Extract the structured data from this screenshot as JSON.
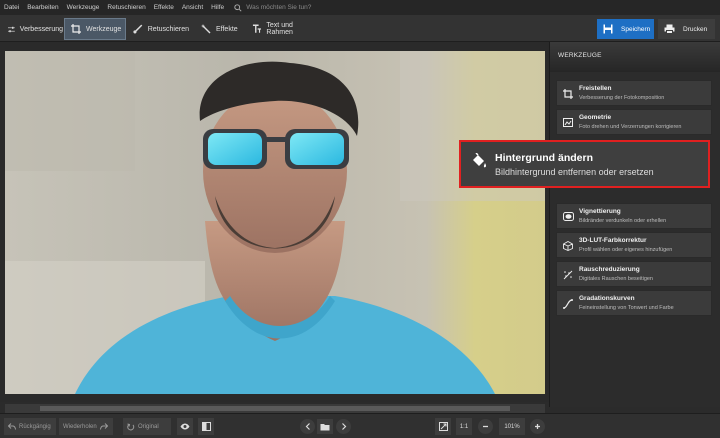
{
  "menu": [
    "Datei",
    "Bearbeiten",
    "Werkzeuge",
    "Retuschieren",
    "Effekte",
    "Ansicht",
    "Hilfe"
  ],
  "search": {
    "placeholder": "Was möchten Sie tun?"
  },
  "tabs": [
    {
      "label": "Verbesserung",
      "icon": "sliders-icon"
    },
    {
      "label": "Werkzeuge",
      "icon": "crop-icon",
      "active": true
    },
    {
      "label": "Retuschieren",
      "icon": "brush-icon"
    },
    {
      "label": "Effekte",
      "icon": "magic-wand-icon"
    },
    {
      "label": "Text und Rahmen",
      "icon": "text-icon"
    }
  ],
  "actions": {
    "save": "Speichern",
    "print": "Drucken"
  },
  "panel": {
    "title": "WERKZEUGE",
    "tools": [
      {
        "title": "Freistellen",
        "desc": "Verbesserung der Fotokomposition",
        "icon": "crop-icon"
      },
      {
        "title": "Geometrie",
        "desc": "Foto drehen und Verzerrungen korrigieren",
        "icon": "geometry-icon"
      },
      {
        "title": "Vignettierung",
        "desc": "Bildränder verdunkeln oder erhellen",
        "icon": "vignette-icon"
      },
      {
        "title": "3D-LUT-Farbkorrektur",
        "desc": "Profil wählen oder eigenes hinzufügen",
        "icon": "lut-cube-icon"
      },
      {
        "title": "Rauschreduzierung",
        "desc": "Digitales Rauschen beseitigen",
        "icon": "noise-icon"
      },
      {
        "title": "Gradationskurven",
        "desc": "Feineinstellung von Tonwert und Farbe",
        "icon": "curve-icon"
      }
    ],
    "highlight": {
      "title": "Hintergrund ändern",
      "desc": "Bildhintergrund entfernen oder ersetzen",
      "icon": "paint-bucket-icon",
      "border_color": "#e02020"
    }
  },
  "bottom": {
    "undo": "Rückgängig",
    "redo": "Wiederholen",
    "original": "Original",
    "ratio": "1:1",
    "zoom": "101%"
  },
  "colors": {
    "accent": "#1e6fc4",
    "active_tab": "#4b5866"
  }
}
